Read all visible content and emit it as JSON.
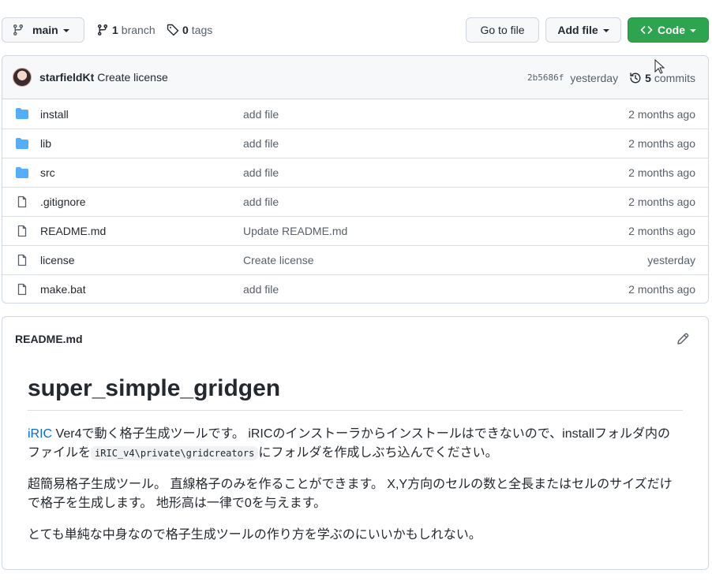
{
  "toolbar": {
    "branch_name": "main",
    "branch_count": "1",
    "branch_label": "branch",
    "tag_count": "0",
    "tag_label": "tags",
    "goto_file": "Go to file",
    "add_file": "Add file",
    "code": "Code"
  },
  "commit": {
    "author": "starfieldKt",
    "message": "Create license",
    "sha": "2b5686f",
    "when": "yesterday",
    "commit_count": "5",
    "commit_label": "commits"
  },
  "files": [
    {
      "name": "install",
      "type": "folder",
      "message": "add file",
      "age": "2 months ago"
    },
    {
      "name": "lib",
      "type": "folder",
      "message": "add file",
      "age": "2 months ago"
    },
    {
      "name": "src",
      "type": "folder",
      "message": "add file",
      "age": "2 months ago"
    },
    {
      "name": ".gitignore",
      "type": "file",
      "message": "add file",
      "age": "2 months ago"
    },
    {
      "name": "README.md",
      "type": "file",
      "message": "Update README.md",
      "age": "2 months ago"
    },
    {
      "name": "license",
      "type": "file",
      "message": "Create license",
      "age": "yesterday"
    },
    {
      "name": "make.bat",
      "type": "file",
      "message": "add file",
      "age": "2 months ago"
    }
  ],
  "readme": {
    "filename": "README.md",
    "heading": "super_simple_gridgen",
    "p1_link": "iRIC",
    "p1_text_a": " Ver4で動く格子生成ツールです。 iRICのインストーラからインストールはできないので、installフォルダ内のファイルを",
    "p1_code": "iRIC_v4\\private\\gridcreators",
    "p1_text_b": "にフォルダを作成しぶち込んでください。",
    "p2": "超簡易格子生成ツール。 直線格子のみを作ることができます。 X,Y方向のセルの数と全長またはセルのサイズだけで格子を生成します。 地形高は一律で0を与えます。",
    "p3": "とても単純な中身なので格子生成ツールの作り方を学ぶのにいいかもしれない。"
  },
  "colors": {
    "accent_green": "#2da44e",
    "folder_blue": "#54aeff",
    "link_blue": "#0969da"
  }
}
